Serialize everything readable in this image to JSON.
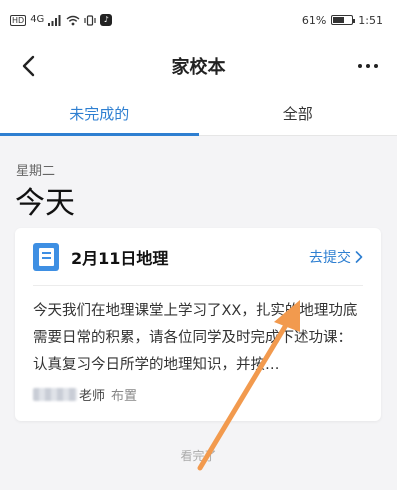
{
  "status_bar": {
    "hd": "HD",
    "network": "4G",
    "battery_percent": "61%",
    "battery_level": 0.61,
    "time": "1:51"
  },
  "header": {
    "title": "家校本"
  },
  "tabs": [
    {
      "label": "未完成的",
      "active": true
    },
    {
      "label": "全部",
      "active": false
    }
  ],
  "section": {
    "weekday": "星期二",
    "day_label": "今天"
  },
  "card": {
    "title": "2月11日地理",
    "action_label": "去提交",
    "body": "今天我们在地理课堂上学习了XX，扎实的地理功底需要日常的积累，请各位同学及时完成下述功课：认真复习今日所学的地理知识，并按…",
    "teacher_suffix": "老师",
    "status": "布置"
  },
  "footer": {
    "end_text": "看完了"
  },
  "colors": {
    "accent": "#2e7fd1",
    "icon_blue": "#3e8fe3",
    "annotation_arrow": "#f29a4e",
    "background": "#f4f4f6"
  },
  "icons": {
    "back": "chevron-left-icon",
    "more": "more-dots-icon",
    "subject": "book-icon",
    "action": "chevron-right-icon"
  }
}
